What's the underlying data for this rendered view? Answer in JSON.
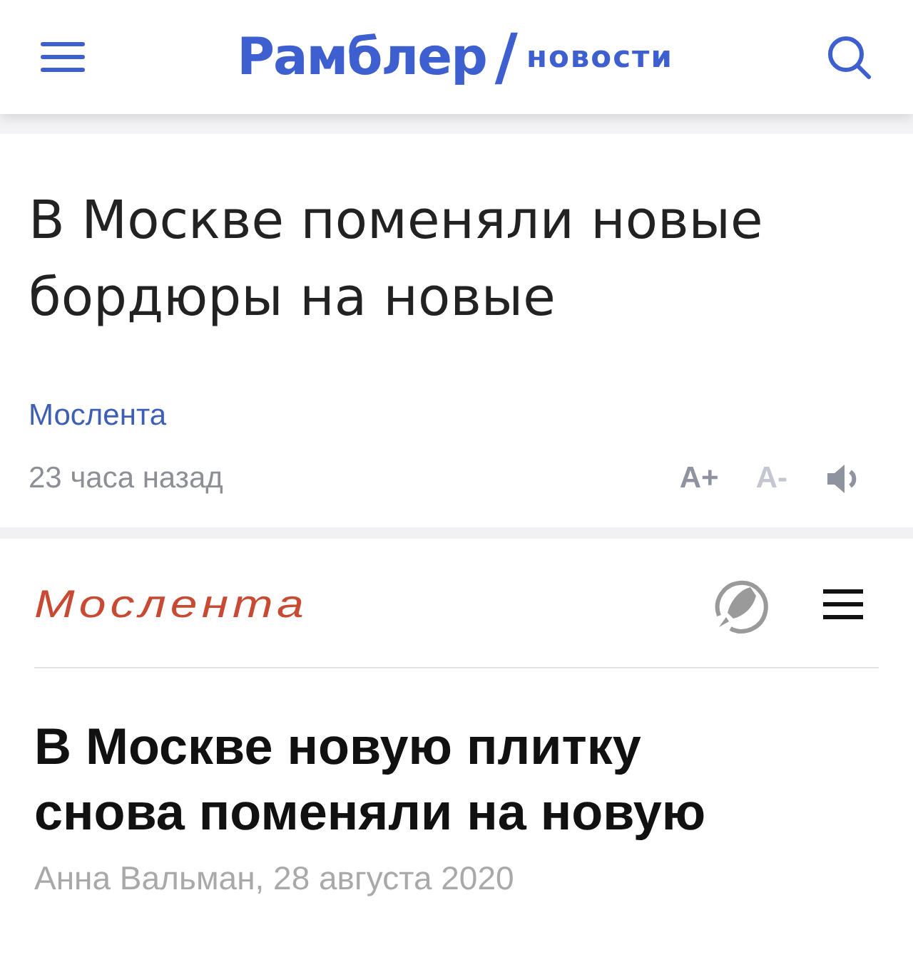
{
  "rambler_header": {
    "logo": "Рамблер",
    "slash": "/",
    "section": "новости"
  },
  "article": {
    "title": "В Москве поменяли новые бордюры на новые",
    "source": "Мослента",
    "time": "23 часа назад",
    "text_controls": [
      {
        "label": "A+",
        "disabled": false
      },
      {
        "label": "A-",
        "disabled": true
      }
    ]
  },
  "moslenta_header": {
    "logo": "Мослента"
  },
  "moslenta_article": {
    "title": "В Москве новую плитку снова поменяли на новую",
    "byline": "Анна Вальман, 28 августа 2020"
  }
}
